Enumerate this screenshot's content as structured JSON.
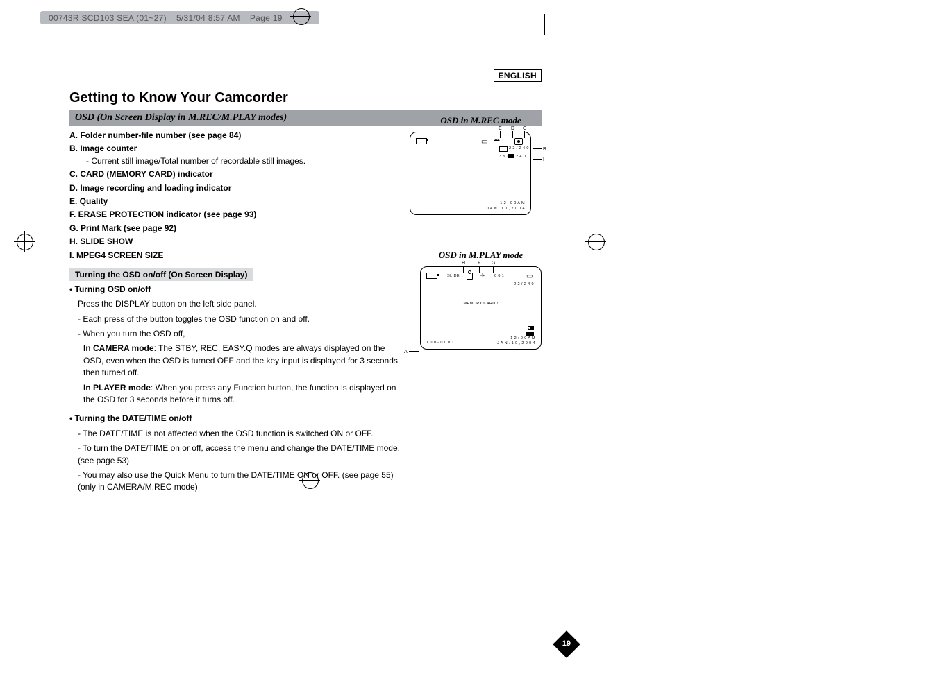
{
  "print_header": {
    "job": "00743R SCD103 SEA (01~27)",
    "date": "5/31/04 8:57 AM",
    "page": "Page 19"
  },
  "language_label": "ENGLISH",
  "section_title": "Getting to Know Your Camcorder",
  "subsection_bar": "OSD (On Screen Display in M.REC/M.PLAY modes)",
  "osd_items": {
    "A": {
      "label": "A. Folder number-file number (see page 84)"
    },
    "B": {
      "label": "B. Image counter",
      "sub": "- Current still image/Total number of recordable still images."
    },
    "C": {
      "label": "C. CARD (MEMORY CARD) indicator"
    },
    "D": {
      "label": "D. Image recording and loading indicator"
    },
    "E": {
      "label": "E. Quality"
    },
    "F": {
      "label": "F. ERASE PROTECTION indicator (see page 93)"
    },
    "G": {
      "label": "G. Print Mark (see page 92)"
    },
    "H": {
      "label": "H. SLIDE SHOW"
    },
    "I": {
      "label": "I.  MPEG4 SCREEN SIZE"
    }
  },
  "grey_bar": "Turning the OSD on/off (On Screen Display)",
  "part1": {
    "heading": "• Turning OSD on/off",
    "line1": "Press the DISPLAY button on the left side panel.",
    "line2": "- Each press of the button toggles the OSD function on and off.",
    "line3": "- When you turn the OSD off,",
    "camera_mode_label": "In CAMERA mode",
    "camera_mode_text": ": The STBY, REC, EASY.Q modes are always displayed on the OSD, even when the OSD is turned OFF and the key input is displayed for 3 seconds then turned off.",
    "player_mode_label": "In PLAYER mode",
    "player_mode_text": ": When you press any Function button, the function is displayed on the OSD for 3 seconds before it turns off."
  },
  "part2": {
    "heading": "• Turning the DATE/TIME on/off",
    "line1": "- The DATE/TIME is not affected when the OSD function is switched ON or OFF.",
    "line2": "- To turn the DATE/TIME on or off, access the menu and change the DATE/TIME mode. (see page 53)",
    "line3": "- You may also use the Quick Menu to turn the DATE/TIME ON or OFF. (see page 55) (only in CAMERA/M.REC mode)"
  },
  "fig_mrec": {
    "title": "OSD in M.REC mode",
    "callouts": {
      "E": "E",
      "D": "D",
      "C": "C",
      "B": "B",
      "I": "I"
    },
    "inside": {
      "counter": "2 2 / 2 4 0",
      "size": "3 5 2",
      "size2": "2 4 0",
      "time": "1 2 : 0 0 A M",
      "date": "J A N . 1 0 , 2 0 0 4"
    }
  },
  "fig_mplay": {
    "title": "OSD in M.PLAY mode",
    "callouts": {
      "H": "H",
      "F": "F",
      "G": "G",
      "A": "A"
    },
    "inside": {
      "slide": "SLIDE",
      "num": "0 0 1",
      "counter": "2 2 / 2 4 0",
      "memcard": "MEMORY CARD !",
      "folder": "1 0 0 - 0 0 0 1",
      "time": "1 2 : 0 0 A M",
      "date": "J A N . 1 0 , 2 0 0 4"
    }
  },
  "page_number": "19"
}
